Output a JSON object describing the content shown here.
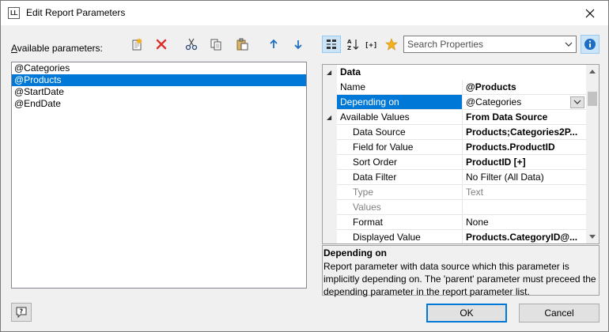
{
  "window": {
    "title": "Edit Report Parameters",
    "app_icon_text": "LL"
  },
  "left": {
    "available_label": "Available parameters:",
    "available_label_mnemonic": "A",
    "available_label_rest": "vailable parameters:",
    "parameters": [
      "@Categories",
      "@Products",
      "@StartDate",
      "@EndDate"
    ],
    "selected_index": 1
  },
  "toolbar_left": [
    "new-parameter-icon",
    "delete-icon",
    "cut-icon",
    "copy-icon",
    "paste-icon",
    "move-up-icon",
    "move-down-icon"
  ],
  "toolbar_right": {
    "categorized_active": true,
    "search_placeholder": "Search Properties",
    "info_active": true
  },
  "grid": {
    "category": "Data",
    "rows": [
      {
        "name": "Name",
        "value": "@Products",
        "bold": true
      },
      {
        "name": "Depending on",
        "value": "@Categories",
        "bold": false,
        "selected": true,
        "dropdown": true
      },
      {
        "name": "Available Values",
        "value": "From Data Source",
        "bold": true,
        "expanded": true
      },
      {
        "name": "Data Source",
        "value": "Products;Categories2P...",
        "bold": true,
        "indent": true
      },
      {
        "name": "Field for Value",
        "value": "Products.ProductID",
        "bold": true,
        "indent": true
      },
      {
        "name": "Sort Order",
        "value": "ProductID [+]",
        "bold": true,
        "indent": true
      },
      {
        "name": "Data Filter",
        "value": "No Filter (All Data)",
        "bold": false,
        "indent": true
      },
      {
        "name": "Type",
        "value": "Text",
        "bold": false,
        "indent": true,
        "disabled": true
      },
      {
        "name": "Values",
        "value": "",
        "bold": false,
        "indent": true,
        "disabled": true
      },
      {
        "name": "Format",
        "value": "None",
        "bold": false,
        "indent": true
      },
      {
        "name": "Displayed Value",
        "value": "Products.CategoryID@...",
        "bold": true,
        "indent": true
      }
    ]
  },
  "description": {
    "title": "Depending on",
    "line1": "Report parameter with data source which this parameter is",
    "line2": "implicitly depending on. The 'parent' parameter must preceed the",
    "line3": "depending parameter in the report parameter list."
  },
  "buttons": {
    "ok": "OK",
    "cancel": "Cancel",
    "help": "?"
  },
  "colors": {
    "selection": "#0078d7",
    "delete_red": "#d9312b",
    "arrow_blue": "#1e6fc4",
    "star": "#f2b01e"
  }
}
